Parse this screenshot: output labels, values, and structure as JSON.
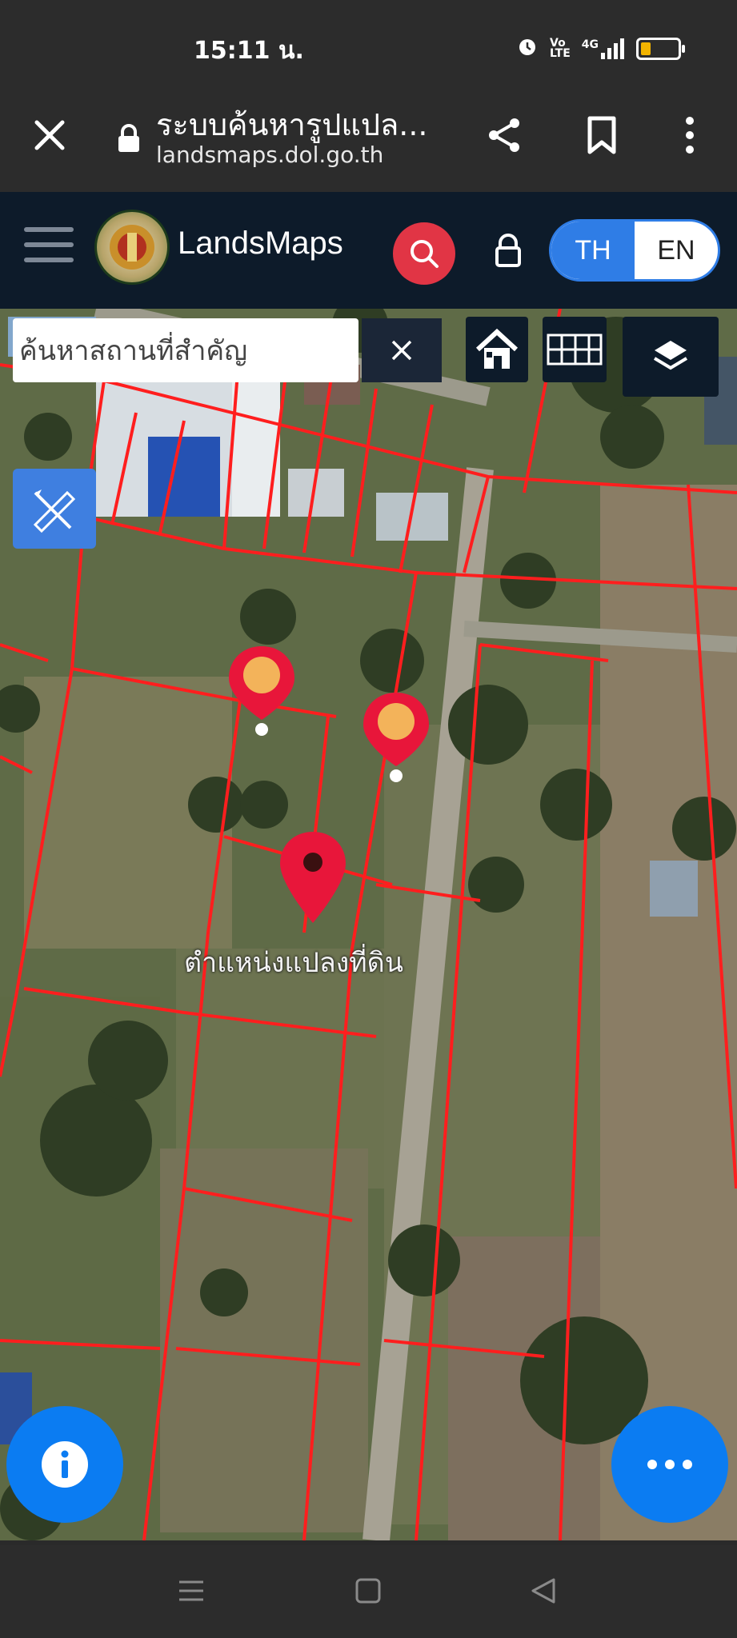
{
  "status": {
    "time": "15:11 น.",
    "signal_text": "4G"
  },
  "browser": {
    "title": "ระบบค้นหารูปแปล...",
    "url": "landsmaps.dol.go.th"
  },
  "app": {
    "brand": "LandsMaps",
    "lang_th": "TH",
    "lang_en": "EN"
  },
  "map": {
    "search_placeholder": "ค้นหาสถานที่สำคัญ",
    "parcel_label": "ตำแหน่งแปลงที่ดิน",
    "pins": [
      {
        "type": "poi",
        "color": "#e8163a"
      },
      {
        "type": "poi",
        "color": "#e8163a"
      },
      {
        "type": "parcel",
        "color": "#e8163a"
      }
    ],
    "parcel_line_color": "#ff1e1e"
  },
  "icons": {
    "close": "close-icon",
    "lock": "lock-icon",
    "share": "share-icon",
    "bookmark": "bookmark-icon",
    "more": "more-vertical-icon",
    "menu": "hamburger-icon",
    "search": "search-icon",
    "home": "home-icon",
    "grid": "grid-icon",
    "layers": "layers-icon",
    "draw": "ruler-pencil-icon",
    "info": "info-icon",
    "dots": "more-horizontal-icon"
  },
  "colors": {
    "header": "#0d1b2a",
    "accent_blue": "#2f7de6",
    "search_red": "#e13545",
    "fab_blue": "#0b7cf2"
  }
}
